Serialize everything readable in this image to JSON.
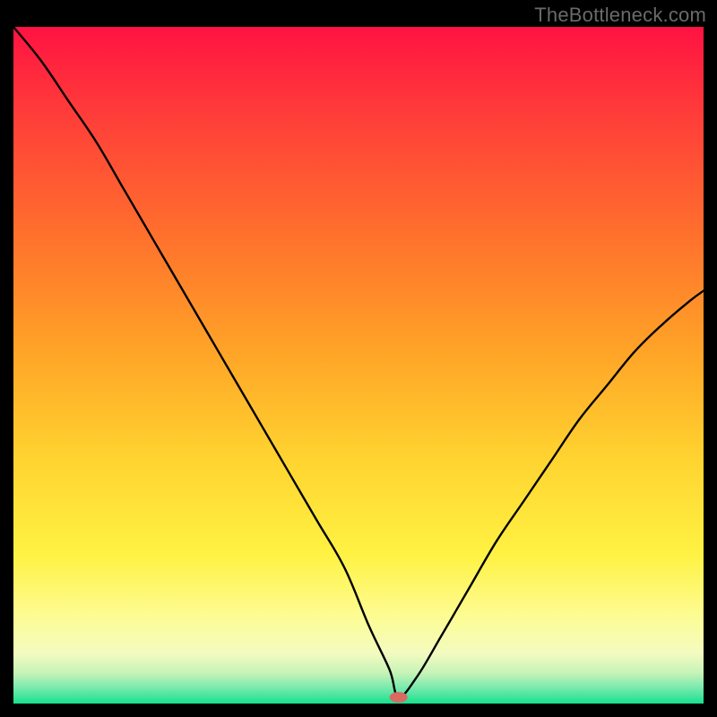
{
  "watermark": "TheBottleneck.com",
  "marker": {
    "x": 0.558,
    "fill": "#d86a62",
    "rx": 10,
    "ry": 6
  },
  "gradient_stops": [
    {
      "offset": 0.0,
      "color": "#ff1242"
    },
    {
      "offset": 0.12,
      "color": "#ff3a3a"
    },
    {
      "offset": 0.3,
      "color": "#ff6e2d"
    },
    {
      "offset": 0.48,
      "color": "#ffa427"
    },
    {
      "offset": 0.64,
      "color": "#ffd430"
    },
    {
      "offset": 0.78,
      "color": "#fff243"
    },
    {
      "offset": 0.87,
      "color": "#fdfc92"
    },
    {
      "offset": 0.925,
      "color": "#f4fbc0"
    },
    {
      "offset": 0.955,
      "color": "#c6f3b7"
    },
    {
      "offset": 0.978,
      "color": "#74e9ac"
    },
    {
      "offset": 1.0,
      "color": "#17e08e"
    }
  ],
  "chart_data": {
    "type": "line",
    "title": "",
    "xlabel": "",
    "ylabel": "",
    "xlim": [
      0,
      1
    ],
    "ylim": [
      0,
      1
    ],
    "x": [
      0.0,
      0.04,
      0.08,
      0.12,
      0.16,
      0.2,
      0.24,
      0.28,
      0.32,
      0.36,
      0.4,
      0.44,
      0.48,
      0.515,
      0.545,
      0.558,
      0.585,
      0.62,
      0.66,
      0.7,
      0.74,
      0.78,
      0.82,
      0.86,
      0.9,
      0.94,
      0.98,
      1.0
    ],
    "values": [
      1.0,
      0.95,
      0.89,
      0.83,
      0.76,
      0.69,
      0.62,
      0.55,
      0.48,
      0.41,
      0.34,
      0.27,
      0.2,
      0.115,
      0.05,
      0.01,
      0.04,
      0.1,
      0.17,
      0.24,
      0.3,
      0.36,
      0.42,
      0.47,
      0.52,
      0.56,
      0.595,
      0.61
    ],
    "marker_x": 0.558,
    "marker_y": 0.01,
    "legend": []
  }
}
